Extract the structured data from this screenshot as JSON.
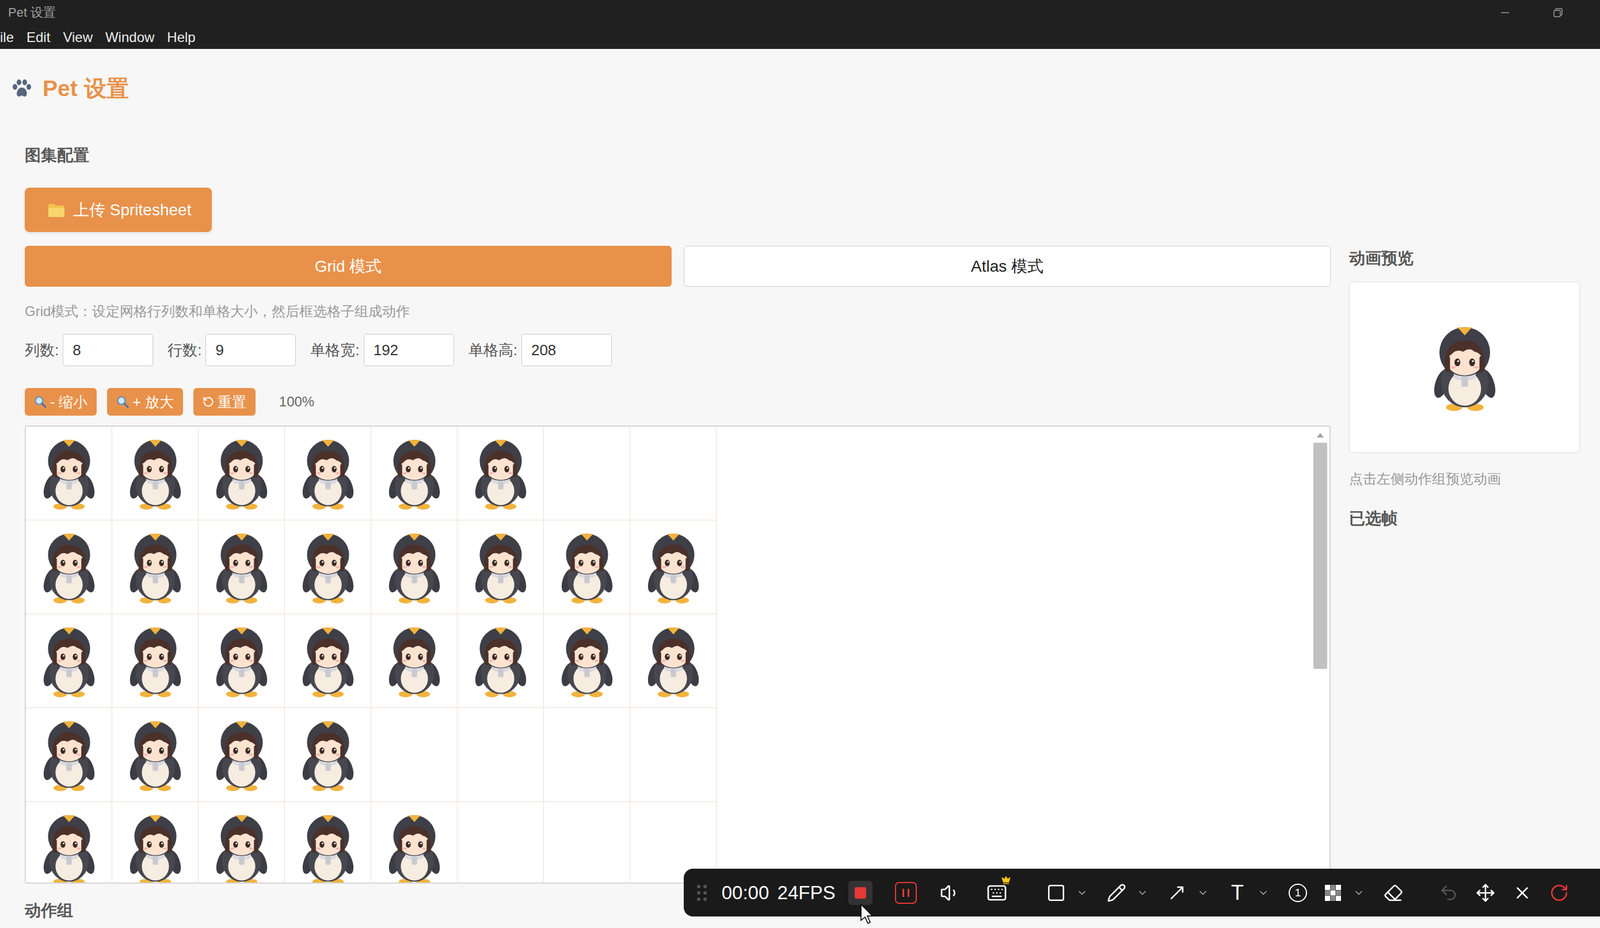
{
  "window": {
    "title": "Pet 设置"
  },
  "menu": [
    {
      "label": "ile"
    },
    {
      "label": "Edit"
    },
    {
      "label": "View"
    },
    {
      "label": "Window"
    },
    {
      "label": "Help"
    }
  ],
  "header": {
    "title": "Pet 设置"
  },
  "atlas": {
    "section_title": "图集配置",
    "upload_button": "上传 Spritesheet",
    "modes": [
      {
        "label": "Grid 模式",
        "selected": true
      },
      {
        "label": "Atlas 模式",
        "selected": false
      }
    ],
    "hint": "Grid模式：设定网格行列数和单格大小，然后框选格子组成动作",
    "fields": [
      {
        "label": "列数:",
        "value": "8"
      },
      {
        "label": "行数:",
        "value": "9"
      },
      {
        "label": "单格宽:",
        "value": "192"
      },
      {
        "label": "单格高:",
        "value": "208"
      }
    ],
    "zoom_buttons": [
      {
        "label": "- 缩小",
        "kind": "zoom-out"
      },
      {
        "label": "+ 放大",
        "kind": "zoom-in"
      },
      {
        "label": "重置",
        "kind": "reset"
      }
    ],
    "zoom_level": "100%",
    "sheet_rows": [
      {
        "frames": [
          true,
          true,
          true,
          true,
          true,
          true,
          false,
          false
        ]
      },
      {
        "frames": [
          true,
          true,
          true,
          true,
          true,
          true,
          true,
          true
        ]
      },
      {
        "frames": [
          true,
          true,
          true,
          true,
          true,
          true,
          true,
          true
        ]
      },
      {
        "frames": [
          true,
          true,
          true,
          true,
          false,
          false,
          false,
          false
        ]
      },
      {
        "frames": [
          true,
          true,
          true,
          true,
          true,
          false,
          false,
          false
        ]
      }
    ],
    "scrollbar": {
      "position": 0,
      "level": 0.52
    }
  },
  "action_groups": {
    "title": "动作组"
  },
  "preview": {
    "title": "动画预览",
    "hint": "点击左侧动作组预览动画",
    "selected_frames_title": "已选帧"
  },
  "recorder": {
    "time": "00:00",
    "fps": "24FPS",
    "recording": true,
    "tools": [
      {
        "kind": "rectangle",
        "dropdown": true
      },
      {
        "kind": "pen",
        "dropdown": true
      },
      {
        "kind": "arrow",
        "dropdown": true
      },
      {
        "kind": "text",
        "label": "T",
        "dropdown": true
      },
      {
        "kind": "step",
        "label": "1",
        "dropdown": false
      },
      {
        "kind": "mosaic",
        "dropdown": true
      },
      {
        "kind": "eraser",
        "dropdown": false
      }
    ],
    "actions": [
      {
        "kind": "undo",
        "disabled": true
      },
      {
        "kind": "move",
        "disabled": false
      },
      {
        "kind": "close",
        "disabled": false
      },
      {
        "kind": "restart",
        "disabled": false
      }
    ]
  }
}
